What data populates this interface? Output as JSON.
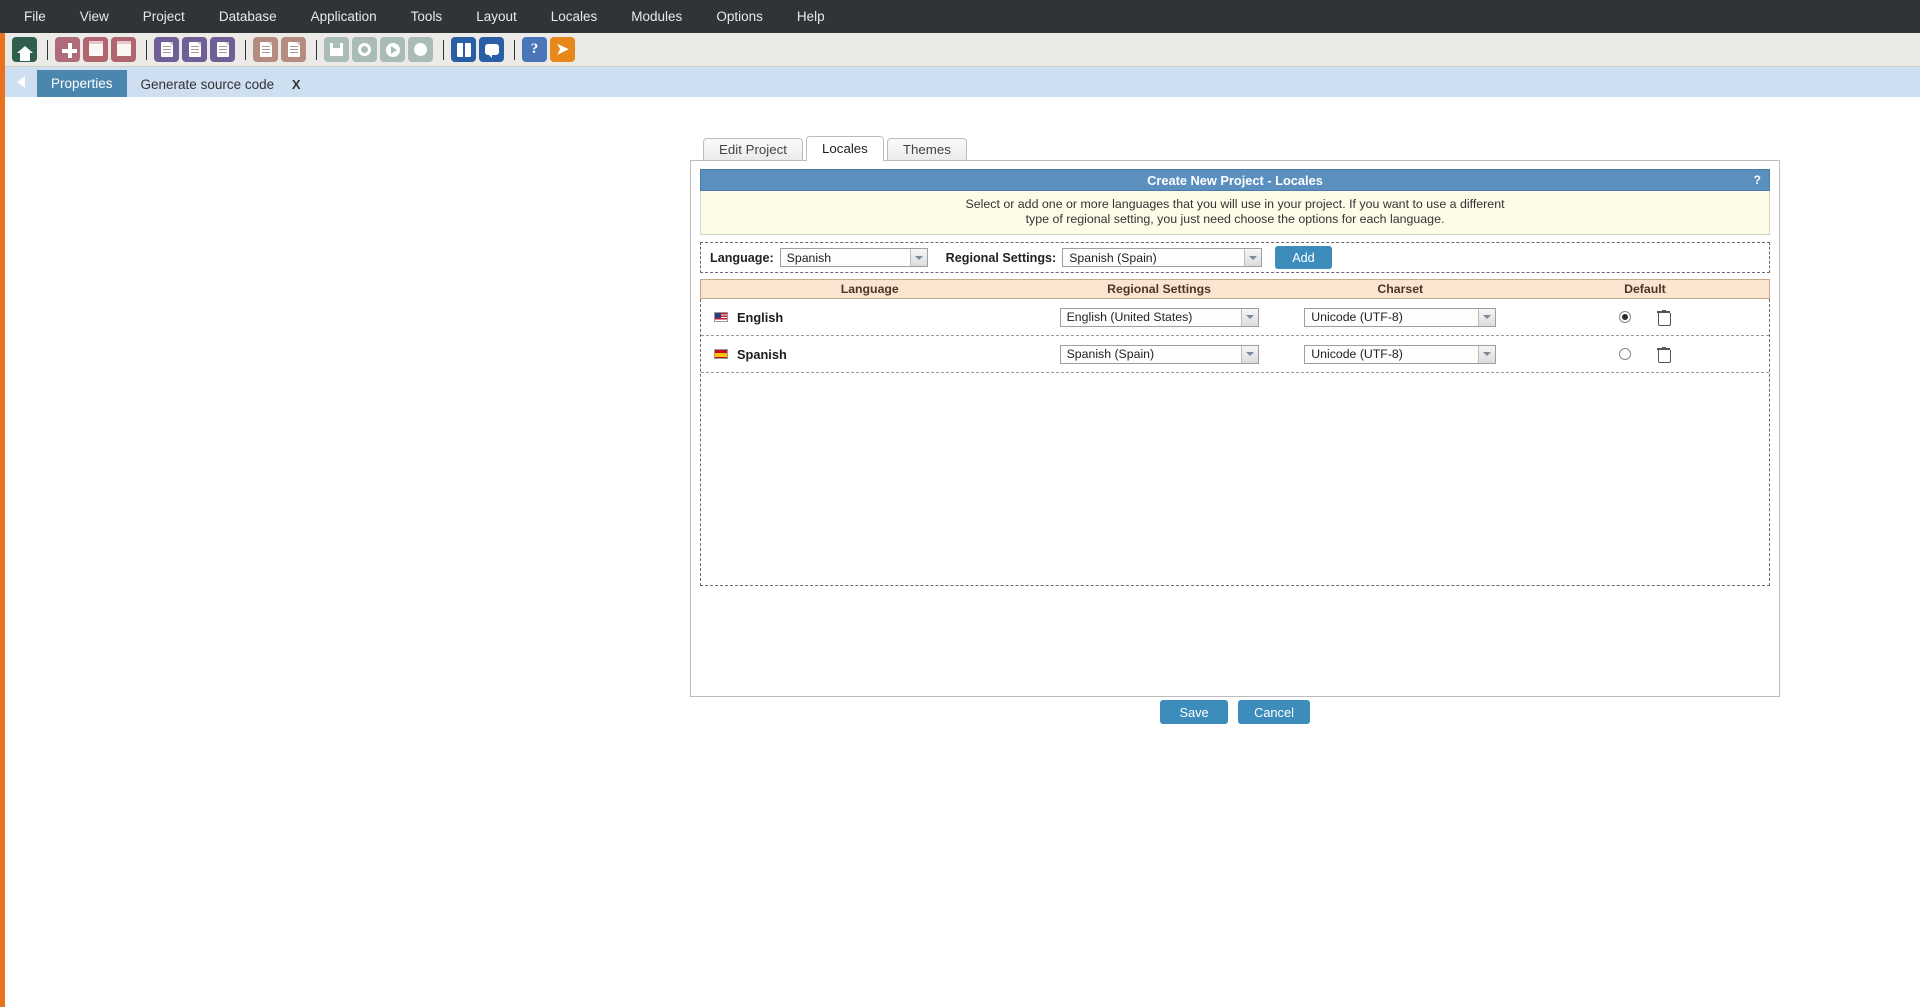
{
  "menubar": {
    "items": [
      {
        "label": "File"
      },
      {
        "label": "View"
      },
      {
        "label": "Project"
      },
      {
        "label": "Database"
      },
      {
        "label": "Application"
      },
      {
        "label": "Tools"
      },
      {
        "label": "Layout"
      },
      {
        "label": "Locales"
      },
      {
        "label": "Modules"
      },
      {
        "label": "Options"
      },
      {
        "label": "Help"
      }
    ]
  },
  "toolbar": {
    "icons": [
      {
        "name": "home-icon",
        "color": "#2f5d4f"
      },
      {
        "name": "new-project-icon",
        "color": "#b06b7a"
      },
      {
        "name": "open-project-icon",
        "color": "#b0656f"
      },
      {
        "name": "close-project-icon",
        "color": "#b0656f"
      },
      {
        "name": "new-application-icon",
        "color": "#6f5f96"
      },
      {
        "name": "edit-application-icon",
        "color": "#6f5f96"
      },
      {
        "name": "list-applications-icon",
        "color": "#6f5f96"
      },
      {
        "name": "new-document-icon",
        "color": "#b68b80"
      },
      {
        "name": "copy-document-icon",
        "color": "#b68b80"
      },
      {
        "name": "save-icon",
        "color": "#a9bdb6"
      },
      {
        "name": "settings-icon",
        "color": "#a9bdb6"
      },
      {
        "name": "run-icon",
        "color": "#a9bdb6"
      },
      {
        "name": "deploy-icon",
        "color": "#a9bdb6"
      },
      {
        "name": "manual-icon",
        "color": "#2a5fa5"
      },
      {
        "name": "support-chat-icon",
        "color": "#2a5fa5"
      },
      {
        "name": "help-icon",
        "color": "#4a76b8"
      },
      {
        "name": "exit-icon",
        "color": "#e8881c"
      }
    ]
  },
  "tabstrip": {
    "back_arrow": "back-arrow-icon",
    "tabs": [
      {
        "label": "Properties",
        "active": true,
        "closable": false
      },
      {
        "label": "Generate source code",
        "active": false,
        "closable": true,
        "close_label": "X"
      }
    ]
  },
  "dialog": {
    "tabs": [
      {
        "label": "Edit Project",
        "active": false
      },
      {
        "label": "Locales",
        "active": true
      },
      {
        "label": "Themes",
        "active": false
      }
    ],
    "title": "Create New Project - Locales",
    "help_label": "?",
    "info_line1": "Select or add one or more languages that you will use in your project. If you want to use a different",
    "info_line2": "type of regional setting, you just need choose the options for each language.",
    "selector": {
      "language_label": "Language:",
      "language_value": "Spanish",
      "regional_label": "Regional Settings:",
      "regional_value": "Spanish (Spain)",
      "add_label": "Add"
    },
    "table": {
      "headers": [
        "Language",
        "Regional Settings",
        "Charset",
        "Default"
      ],
      "rows": [
        {
          "flag": "flag-us-icon",
          "language": "English",
          "regional": "English (United States)",
          "charset": "Unicode (UTF-8)",
          "is_default": true,
          "delete_icon": "trash-icon"
        },
        {
          "flag": "flag-es-icon",
          "language": "Spanish",
          "regional": "Spanish (Spain)",
          "charset": "Unicode (UTF-8)",
          "is_default": false,
          "delete_icon": "trash-icon"
        }
      ]
    },
    "footer": {
      "save_label": "Save",
      "cancel_label": "Cancel"
    }
  },
  "annotations": {
    "arrow_color": "#e81c0f",
    "arrow1_target": "english-row-language-cell",
    "arrow2_target": "english-row-default-radio"
  },
  "colors": {
    "menubar_bg": "#2f3437",
    "tabstrip_bg": "#cddff0",
    "accent_blue": "#3c8dbc",
    "panel_title_bg": "#5b8fbe",
    "info_bg": "#fdfce8",
    "table_head_bg": "#fae6d0",
    "rail_orange": "#e8731c"
  }
}
